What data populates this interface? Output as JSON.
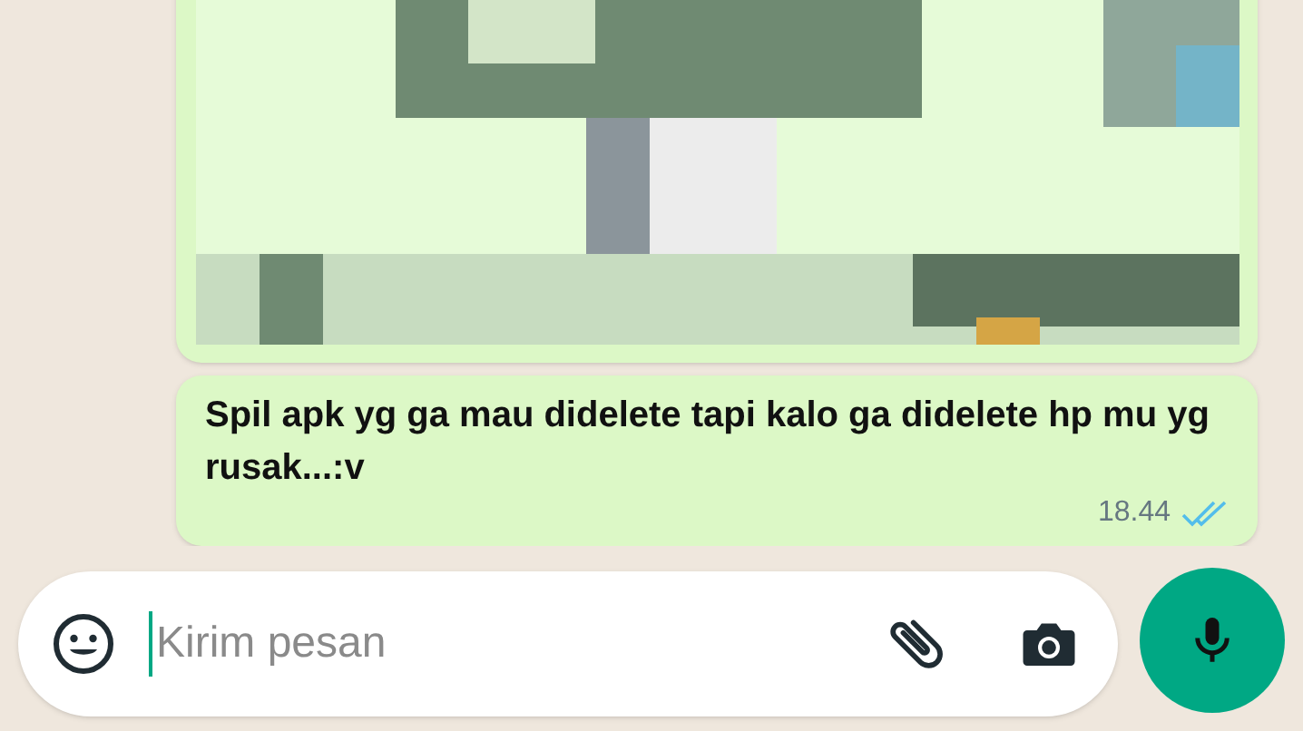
{
  "messages": [
    {
      "kind": "picture"
    },
    {
      "kind": "text",
      "text": "Spil apk yg ga mau didelete tapi kalo ga didelete hp mu yg rusak...:v",
      "time": "18.44",
      "read": true
    }
  ],
  "composer": {
    "placeholder": "Kirim pesan"
  }
}
